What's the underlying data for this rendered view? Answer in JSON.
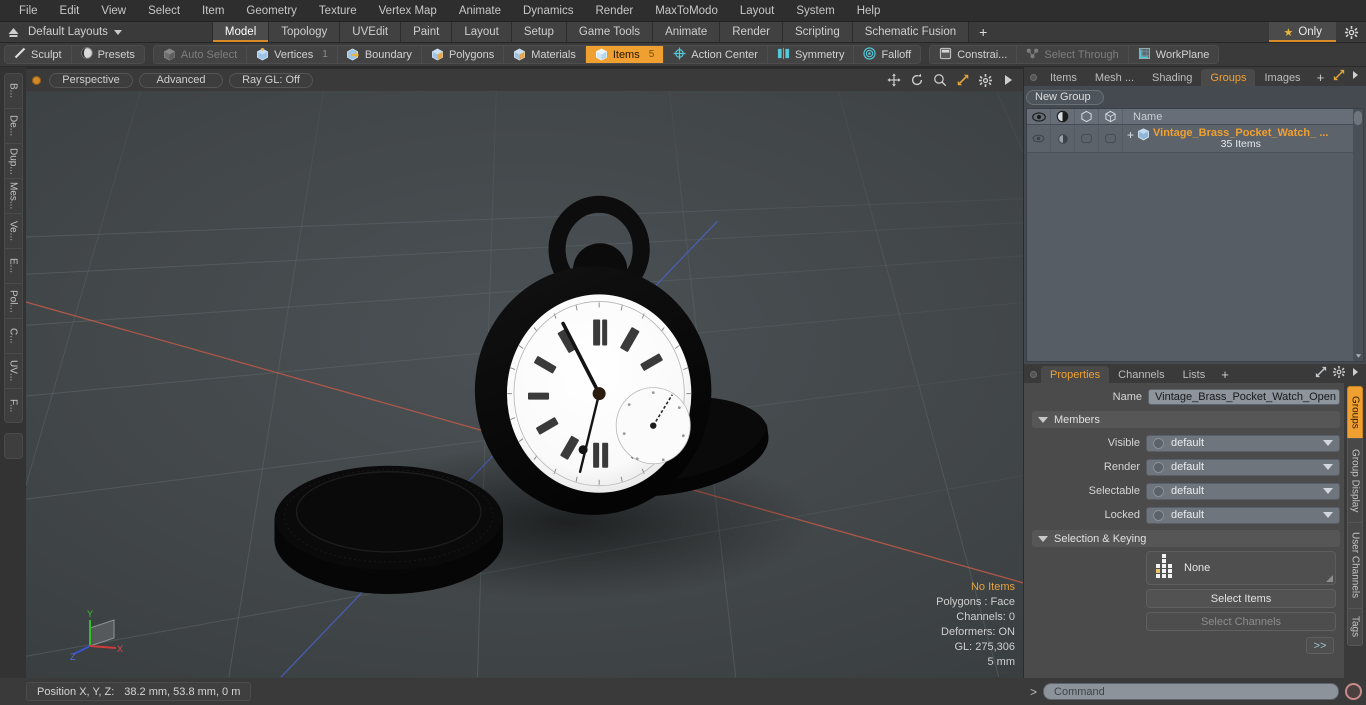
{
  "menubar": {
    "items": [
      "File",
      "Edit",
      "View",
      "Select",
      "Item",
      "Geometry",
      "Texture",
      "Vertex Map",
      "Animate",
      "Dynamics",
      "Render",
      "MaxToModo",
      "Layout",
      "System",
      "Help"
    ]
  },
  "layoutbar": {
    "layout_label": "Default Layouts",
    "tabs": [
      "Model",
      "Topology",
      "UVEdit",
      "Paint",
      "Layout",
      "Setup",
      "Game Tools",
      "Animate",
      "Render",
      "Scripting",
      "Schematic Fusion"
    ],
    "active_tab": "Model",
    "add_label": "+",
    "only_label": "Only",
    "star_glyph": "★"
  },
  "modebar": {
    "group1": [
      {
        "label": "Sculpt",
        "icon": "pencil-icon",
        "state": "normal"
      },
      {
        "label": "Presets",
        "icon": "sphere-icon",
        "state": "normal"
      }
    ],
    "group2": [
      {
        "label": "Auto Select",
        "icon": "cube-icon",
        "state": "dim"
      },
      {
        "label": "Vertices",
        "icon": "cube-vertex-icon",
        "state": "normal",
        "badge": "1"
      },
      {
        "label": "Boundary",
        "icon": "cube-boundary-icon",
        "state": "normal"
      },
      {
        "label": "Polygons",
        "icon": "cube-icon",
        "state": "normal"
      },
      {
        "label": "Materials",
        "icon": "cube-icon",
        "state": "normal"
      },
      {
        "label": "Items",
        "icon": "cube-icon",
        "state": "selected",
        "badge": "5"
      },
      {
        "label": "Action Center",
        "icon": "target-icon",
        "state": "normal"
      },
      {
        "label": "Symmetry",
        "icon": "symmetry-icon",
        "state": "normal"
      },
      {
        "label": "Falloff",
        "icon": "falloff-icon",
        "state": "normal"
      }
    ],
    "group3": [
      {
        "label": "Constrai...",
        "icon": "constrain-icon",
        "state": "normal"
      },
      {
        "label": "Select Through",
        "icon": "select-through-icon",
        "state": "dim"
      },
      {
        "label": "WorkPlane",
        "icon": "workplane-icon",
        "state": "normal"
      }
    ]
  },
  "leftrail": {
    "tabs": [
      "B...",
      "De...",
      "Dup...",
      "Mes...",
      "Ve...",
      "E...",
      "Pol...",
      "C...",
      "UV...",
      "F..."
    ]
  },
  "viewport": {
    "header_buttons": [
      "Perspective",
      "Advanced",
      "Ray GL: Off"
    ],
    "header_icons": [
      "move-icon",
      "rotate-icon",
      "zoom-icon",
      "fullscreen-icon",
      "gear-icon",
      "play-arrow-icon"
    ],
    "status": {
      "items": "No Items",
      "polygons": "Polygons : Face",
      "channels": "Channels: 0",
      "deformers": "Deformers: ON",
      "gl": "GL: 275,306",
      "scale": "5 mm"
    },
    "axis_labels": {
      "x": "X",
      "y": "Y",
      "z": "Z"
    },
    "model": "Vintage brass pocket watch, open, silhouetted"
  },
  "grouppanel": {
    "tabs": [
      "Items",
      "Mesh ...",
      "Shading",
      "Groups",
      "Images"
    ],
    "active_tab": "Groups",
    "add_label": "+",
    "new_group_label": "New Group",
    "columns": [
      "eye-icon",
      "render-icon",
      "cube-outline-icon",
      "cube-wire-icon",
      "Name"
    ],
    "name_header": "Name",
    "rows": [
      {
        "name": "Vintage_Brass_Pocket_Watch_ ...",
        "subtitle": "35 Items",
        "expander": "+"
      }
    ]
  },
  "properties": {
    "tabs": [
      "Properties",
      "Channels",
      "Lists"
    ],
    "active_tab": "Properties",
    "add_label": "+",
    "name_label": "Name",
    "name_value": "Vintage_Brass_Pocket_Watch_Open (",
    "members_section": "Members",
    "fields": [
      {
        "label": "Visible",
        "value": "default"
      },
      {
        "label": "Render",
        "value": "default"
      },
      {
        "label": "Selectable",
        "value": "default"
      },
      {
        "label": "Locked",
        "value": "default"
      }
    ],
    "selection_section": "Selection & Keying",
    "selection_value": "None",
    "select_items_label": "Select Items",
    "select_channels_label": "Select Channels",
    "more_label": ">>"
  },
  "rightrail": {
    "tabs": [
      "Groups",
      "Group Display",
      "User Channels",
      "Tags"
    ],
    "active_tab": "Groups"
  },
  "bottombar": {
    "position_label": "Position X, Y, Z:",
    "position_value": "38.2 mm, 53.8 mm, 0 m",
    "command_prompt": ">",
    "command_placeholder": "Command"
  },
  "colors": {
    "accent": "#f0a030",
    "panel": "#3a3a3a",
    "grid_red": "#b5564a",
    "grid_blue": "#4a5fb5"
  }
}
